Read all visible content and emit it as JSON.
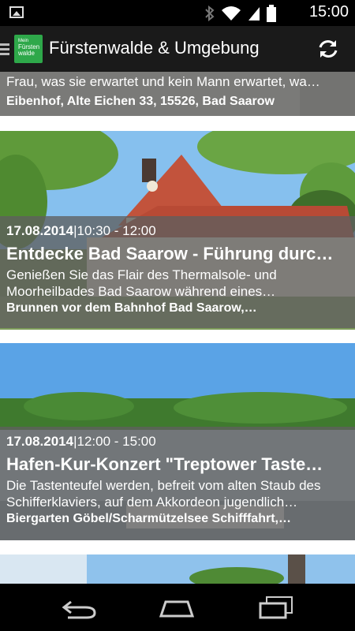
{
  "status_bar": {
    "time": "15:00",
    "icons": [
      "image-notification-icon",
      "bluetooth-icon",
      "wifi-icon",
      "signal-icon",
      "battery-icon"
    ]
  },
  "action_bar": {
    "logo": {
      "line1": "Mein",
      "line2": "Fürsten",
      "line3": "walde"
    },
    "title": "Fürstenwalde & Umgebung",
    "refresh_icon": "refresh-icon"
  },
  "events": [
    {
      "description": "Frau, was sie erwartet und kein Mann erwartet, wa…",
      "location": "Eibenhof, Alte Eichen 33, 15526, Bad Saarow"
    },
    {
      "date": "17.08.2014",
      "time": "10:30 - 12:00",
      "title": "Entdecke Bad Saarow - Führung durc…",
      "description_line1": "Genießen Sie das Flair des Thermalsole- und",
      "description_line2": "Moorheilbades Bad Saarow während eines…",
      "location": "Brunnen vor dem Bahnhof Bad Saarow,…"
    },
    {
      "date": "17.08.2014",
      "time": "12:00 - 15:00",
      "title": "Hafen-Kur-Konzert \"Treptower Taste…",
      "description_line1": "Die Tastenteufel werden, befreit vom alten Staub des",
      "description_line2": "Schifferklaviers, auf dem Akkordeon jugendlich…",
      "location": "Biergarten Göbel/Scharmützelsee Schifffahrt,…"
    }
  ],
  "nav_bar": {
    "icons": [
      "back-icon",
      "home-icon",
      "recent-apps-icon"
    ]
  },
  "colors": {
    "status_bar": "#000000",
    "action_bar": "#1a1a1a",
    "logo_green": "#2ea84a",
    "overlay": "#5f5f5f",
    "sky": "#6fb3ea"
  }
}
